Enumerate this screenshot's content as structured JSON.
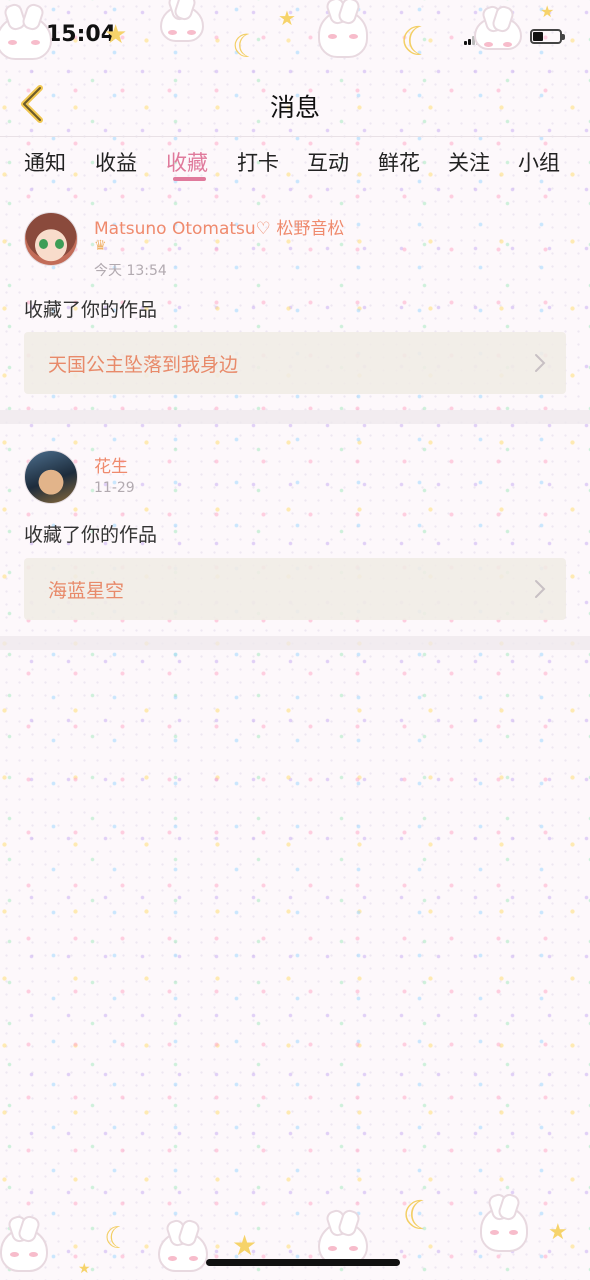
{
  "status_bar": {
    "time": "15:04"
  },
  "header": {
    "title": "消息"
  },
  "tabs": [
    {
      "label": "通知",
      "active": false
    },
    {
      "label": "收益",
      "active": false
    },
    {
      "label": "收藏",
      "active": true
    },
    {
      "label": "打卡",
      "active": false
    },
    {
      "label": "互动",
      "active": false
    },
    {
      "label": "鲜花",
      "active": false
    },
    {
      "label": "关注",
      "active": false
    },
    {
      "label": "小组",
      "active": false
    }
  ],
  "messages": [
    {
      "username": "Matsuno Otomatsu♡ 松野音松",
      "badge": "♛",
      "time": "今天 13:54",
      "action": "收藏了你的作品",
      "work_title": "天国公主坠落到我身边"
    },
    {
      "username": "花生",
      "time": "11-29",
      "action": "收藏了你的作品",
      "work_title": "海蓝星空"
    }
  ],
  "colors": {
    "accent": "#e07a9c",
    "username": "#ef8a6d",
    "work_title": "#e88a6a",
    "timestamp": "#b2aab0"
  },
  "icons": {
    "back": "chevron-left-icon",
    "work_link": "chevron-right-icon",
    "badge": "crown-icon"
  }
}
